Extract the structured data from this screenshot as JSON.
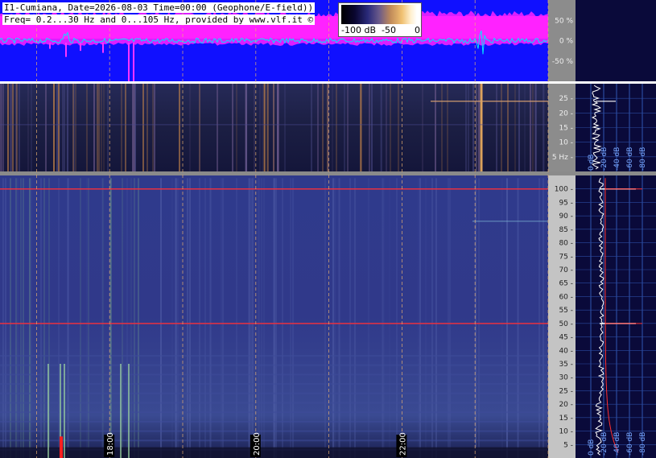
{
  "header": {
    "line1": "I1-Cumiana, Date=2026-08-03 Time=00:00 (Geophone/E-field))",
    "line2": "Freq= 0.2...30 Hz and 0...105 Hz, provided by www.vlf.it ©"
  },
  "colorbar": {
    "min_label": "-100 dB",
    "mid_label": "-50",
    "max_label": "0"
  },
  "chart_data": [
    {
      "type": "line",
      "panel": "amplitude",
      "y_tick_labels": [
        "50 %",
        "0 %",
        "-50 %"
      ],
      "y_ticks": [
        50,
        0,
        -50
      ],
      "ylim": [
        -100,
        100
      ],
      "colors": {
        "background": "#1010ff",
        "envelope": "#ff22ff",
        "trace": "#00e5ff"
      }
    },
    {
      "type": "heatmap",
      "panel": "low-frequency spectrogram",
      "y_tick_labels": [
        "25 -",
        "20 -",
        "15 -",
        "10 -",
        "5 Hz -"
      ],
      "y_ticks": [
        25,
        20,
        15,
        10,
        5
      ],
      "ylim": [
        0,
        30
      ]
    },
    {
      "type": "heatmap",
      "panel": "high-frequency spectrogram",
      "y_tick_labels": [
        "100 -",
        "95 -",
        "90 -",
        "85 -",
        "80 -",
        "75 -",
        "70 -",
        "65 -",
        "60 -",
        "55 -",
        "50 -",
        "45 -",
        "40 -",
        "35 -",
        "30 -",
        "25 -",
        "20 -",
        "15 -",
        "10 -",
        "5 -"
      ],
      "y_ticks": [
        100,
        95,
        90,
        85,
        80,
        75,
        70,
        65,
        60,
        55,
        50,
        45,
        40,
        35,
        30,
        25,
        20,
        15,
        10,
        5
      ],
      "ylim": [
        0,
        105
      ],
      "time_labels": [
        "18:00",
        "20:00",
        "22:00"
      ],
      "time_marks": [
        18,
        20,
        22
      ],
      "time_range": [
        16.5,
        24
      ]
    },
    {
      "type": "line",
      "panel": "side spectrum",
      "x_tick_labels": [
        "0 dB",
        "-20 dB",
        "-40 dB",
        "-60 dB",
        "-80 dB"
      ],
      "peaks": [
        50,
        100
      ],
      "colors": {
        "trace": "#ffffff",
        "average": "#ff3030"
      }
    }
  ]
}
